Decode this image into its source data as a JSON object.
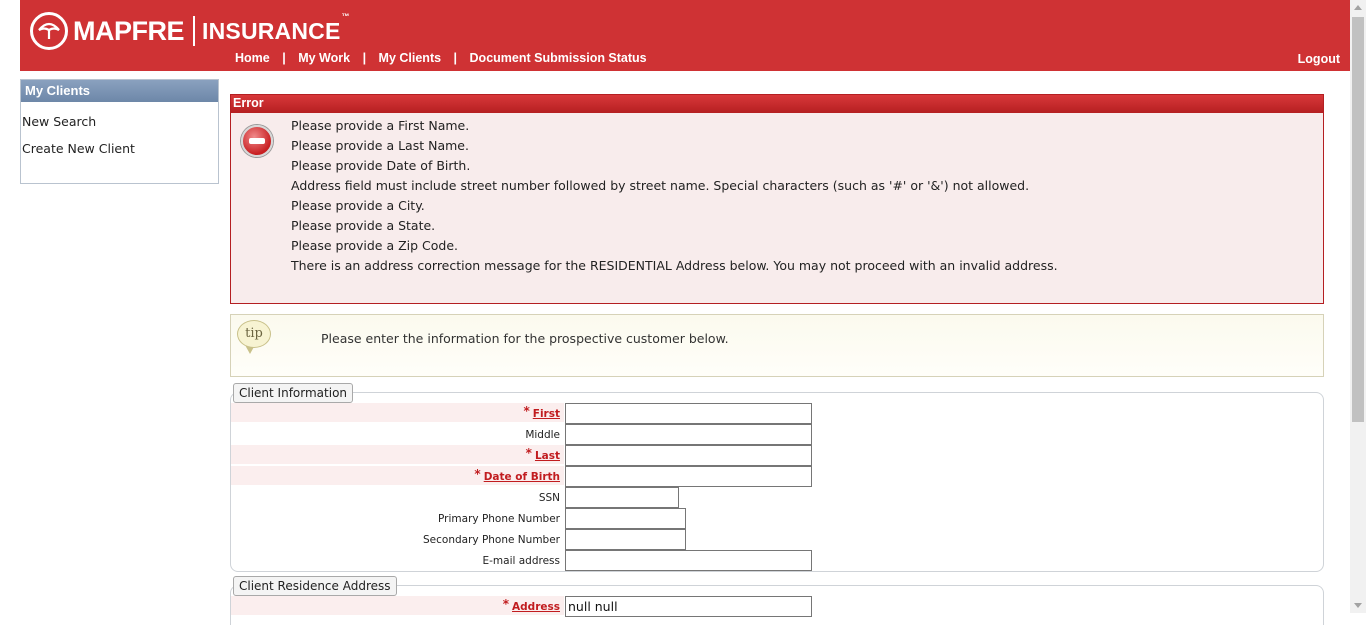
{
  "header": {
    "logo_name": "MAPFRE",
    "logo_suffix": "INSURANCE",
    "logo_tm": "™",
    "nav": [
      "Home",
      "My Work",
      "My Clients",
      "Document Submission Status"
    ],
    "nav_sep": "|",
    "logout": "Logout",
    "brand_color": "#cf3234"
  },
  "sidebar": {
    "title": "My Clients",
    "items": [
      "New Search",
      "Create New Client"
    ]
  },
  "error": {
    "title": "Error",
    "icon": "stop-icon",
    "messages": [
      "Please provide a First Name.",
      "Please provide a Last Name.",
      "Please provide Date of Birth.",
      "Address field must include street number followed by street name. Special characters (such as '#' or '&') not allowed.",
      "Please provide a City.",
      "Please provide a State.",
      "Please provide a Zip Code.",
      "There is an address correction message for the RESIDENTIAL Address below. You may not proceed with an invalid address."
    ]
  },
  "tip": {
    "icon_label": "tip",
    "text": "Please enter the information for the prospective customer below."
  },
  "client_info": {
    "legend": "Client Information",
    "required_mark": "*",
    "fields": {
      "first": {
        "label": "First",
        "value": ""
      },
      "middle": {
        "label": "Middle",
        "value": ""
      },
      "last": {
        "label": "Last",
        "value": ""
      },
      "dob": {
        "label": "Date of Birth",
        "value": ""
      },
      "ssn": {
        "label": "SSN",
        "value": ""
      },
      "primary_phone": {
        "label": "Primary Phone Number",
        "value": ""
      },
      "secondary_phone": {
        "label": "Secondary Phone Number",
        "value": ""
      },
      "email": {
        "label": "E-mail address",
        "value": ""
      }
    }
  },
  "residence": {
    "legend": "Client Residence Address",
    "required_mark": "*",
    "address": {
      "label": "Address",
      "value": "null null"
    }
  }
}
